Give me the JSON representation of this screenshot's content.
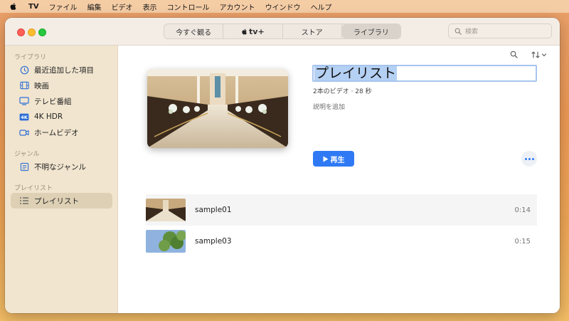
{
  "menubar": {
    "app": "TV",
    "items": [
      "ファイル",
      "編集",
      "ビデオ",
      "表示",
      "コントロール",
      "アカウント",
      "ウインドウ",
      "ヘルプ"
    ]
  },
  "toolbar": {
    "tabs": [
      {
        "label": "今すぐ観る"
      },
      {
        "label": "tv+"
      },
      {
        "label": "ストア"
      },
      {
        "label": "ライブラリ"
      }
    ],
    "active_tab": "ライブラリ",
    "search_placeholder": "検索"
  },
  "sidebar": {
    "library_header": "ライブラリ",
    "library_items": [
      {
        "label": "最近追加した項目",
        "icon": "clock-icon"
      },
      {
        "label": "映画",
        "icon": "film-icon"
      },
      {
        "label": "テレビ番組",
        "icon": "tv-icon"
      },
      {
        "label": "4K HDR",
        "icon": "4k-icon"
      },
      {
        "label": "ホームビデオ",
        "icon": "video-camera-icon"
      }
    ],
    "genre_header": "ジャンル",
    "genre_items": [
      {
        "label": "不明なジャンル",
        "icon": "genre-icon"
      }
    ],
    "playlist_header": "プレイリスト",
    "playlist_items": [
      {
        "label": "プレイリスト",
        "icon": "playlist-icon",
        "selected": true
      }
    ]
  },
  "playlist": {
    "title": "プレイリスト",
    "meta": "2本のビデオ · 28 秒",
    "description_placeholder": "説明を追加",
    "play_label": "再生",
    "videos": [
      {
        "name": "sample01",
        "duration": "0:14"
      },
      {
        "name": "sample03",
        "duration": "0:15"
      }
    ]
  },
  "colors": {
    "accent": "#2f7af4",
    "sidebar_bg": "#f1e5cf",
    "selection": "#b4d0f3"
  }
}
